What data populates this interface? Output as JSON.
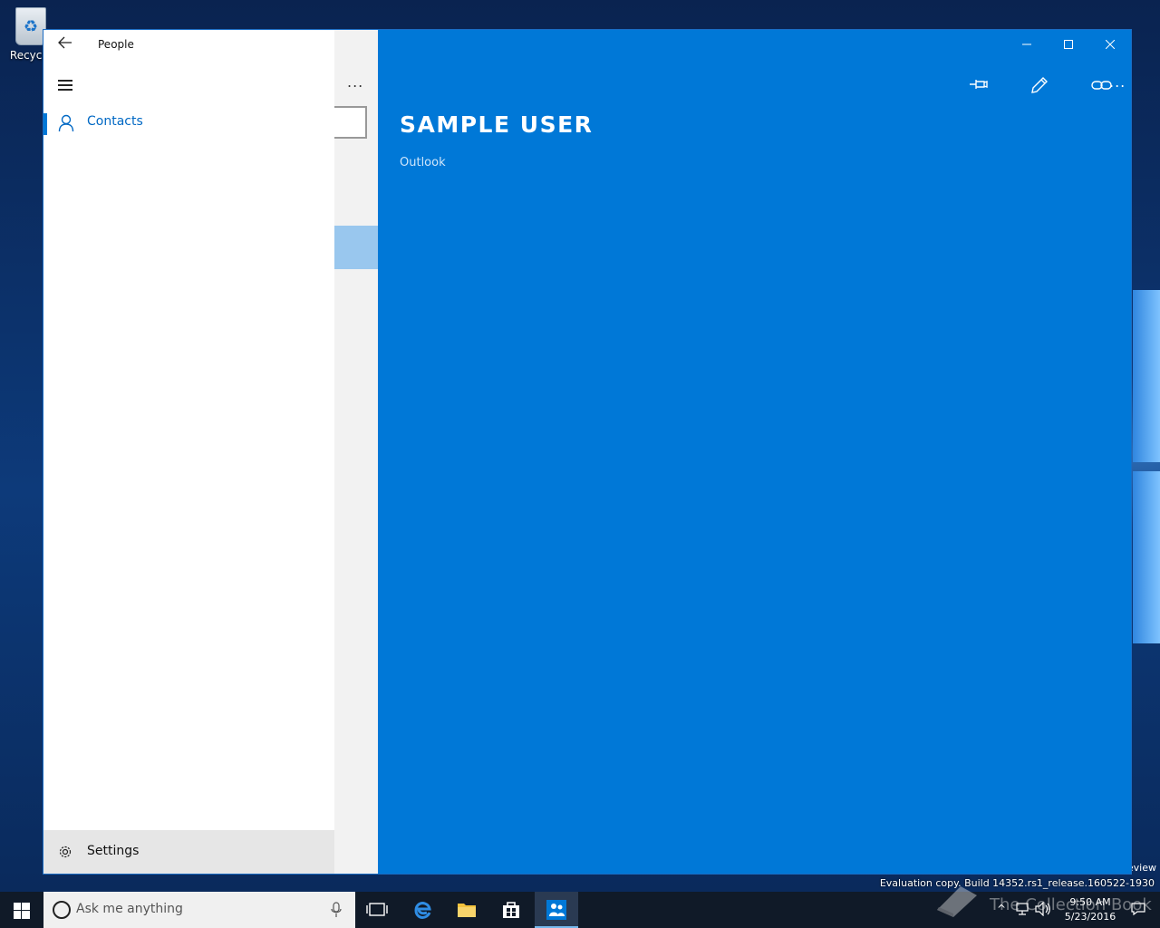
{
  "desktop": {
    "recycle_bin_label": "Recycle",
    "watermark_preview": "eview",
    "evaluation_text": "Evaluation copy. Build 14352.rs1_release.160522-1930",
    "watermark_brand": "The Collection Book"
  },
  "app": {
    "title": "People",
    "nav": {
      "contacts_label": "Contacts",
      "settings_label": "Settings"
    },
    "list": {
      "more_label": "..."
    },
    "detail": {
      "contact_name": "SAMPLE USER",
      "contact_source": "Outlook",
      "more_label": "..."
    }
  },
  "taskbar": {
    "search_placeholder": "Ask me anything",
    "clock_time": "9:50 AM",
    "clock_date": "5/23/2016"
  },
  "colors": {
    "accent": "#0078d7",
    "selection": "#99c7ee"
  }
}
